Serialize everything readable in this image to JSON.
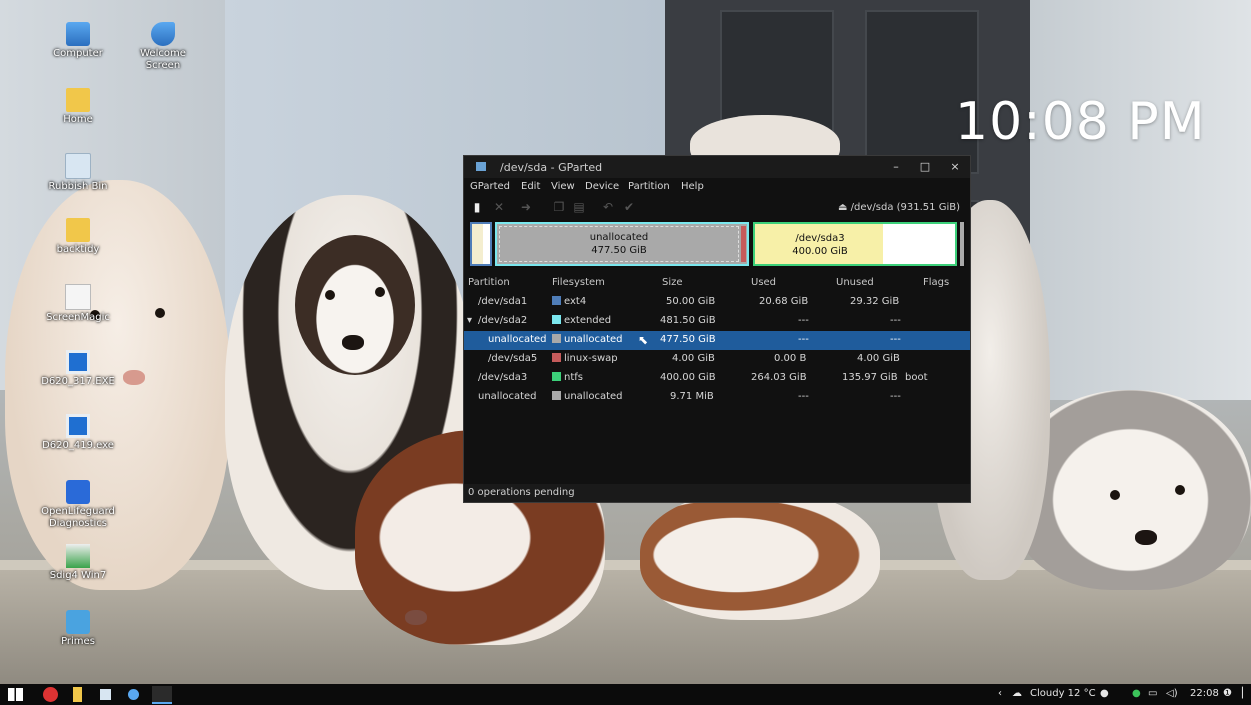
{
  "desktop": {
    "clock": "10:08 PM",
    "icons": [
      {
        "label": "Computer",
        "icon": "computer-icon"
      },
      {
        "label": "Welcome Screen",
        "icon": "bird-icon"
      },
      {
        "label": "Home",
        "icon": "home-folder-icon"
      },
      {
        "label": "Rubbish Bin",
        "icon": "trash-icon"
      },
      {
        "label": "backtidy",
        "icon": "folder-icon"
      },
      {
        "label": "ScreenMagic",
        "icon": "document-icon"
      },
      {
        "label": "D620_317.EXE",
        "icon": "exe-icon"
      },
      {
        "label": "D620_419.exe",
        "icon": "exe-icon"
      },
      {
        "label": "OpenLifeguard Diagnostics",
        "icon": "app-icon"
      },
      {
        "label": "Sdig4 Win7",
        "icon": "installer-icon"
      },
      {
        "label": "Primes",
        "icon": "primes-icon"
      }
    ]
  },
  "window": {
    "title": "/dev/sda - GParted",
    "menu": [
      "GParted",
      "Edit",
      "View",
      "Device",
      "Partition",
      "Help"
    ],
    "device_selector": "/dev/sda  (931.51 GiB)",
    "map": {
      "seg_unalloc": {
        "name": "unallocated",
        "size": "477.50 GiB"
      },
      "seg_sda3": {
        "name": "/dev/sda3",
        "size": "400.00 GiB"
      }
    },
    "columns": [
      "Partition",
      "Filesystem",
      "Size",
      "Used",
      "Unused",
      "Flags"
    ],
    "rows": [
      {
        "partition": "/dev/sda1",
        "fs": "ext4",
        "size": "50.00 GiB",
        "used": "20.68 GiB",
        "unused": "29.32 GiB",
        "flags": "",
        "color": "#4f7db8"
      },
      {
        "partition": "/dev/sda2",
        "fs": "extended",
        "size": "481.50 GiB",
        "used": "---",
        "unused": "---",
        "flags": "",
        "color": "#7be7ee"
      },
      {
        "partition": "unallocated",
        "fs": "unallocated",
        "size": "477.50 GiB",
        "used": "---",
        "unused": "---",
        "flags": "",
        "color": "#a9a9a9"
      },
      {
        "partition": "/dev/sda5",
        "fs": "linux-swap",
        "size": "4.00 GiB",
        "used": "0.00 B",
        "unused": "4.00 GiB",
        "flags": "",
        "color": "#c55b5b"
      },
      {
        "partition": "/dev/sda3",
        "fs": "ntfs",
        "size": "400.00 GiB",
        "used": "264.03 GiB",
        "unused": "135.97 GiB",
        "flags": "boot",
        "color": "#3cd07a"
      },
      {
        "partition": "unallocated",
        "fs": "unallocated",
        "size": "9.71 MiB",
        "used": "---",
        "unused": "---",
        "flags": "",
        "color": "#a9a9a9"
      }
    ],
    "status": "0 operations pending"
  },
  "taskbar": {
    "weather": "Cloudy 12 °C",
    "time": "22:08"
  },
  "colors": {
    "selection": "#1f5c9c",
    "unallocated": "#a9a9a9",
    "ntfs": "#3cd07a",
    "extended_border": "#7be7ee"
  }
}
